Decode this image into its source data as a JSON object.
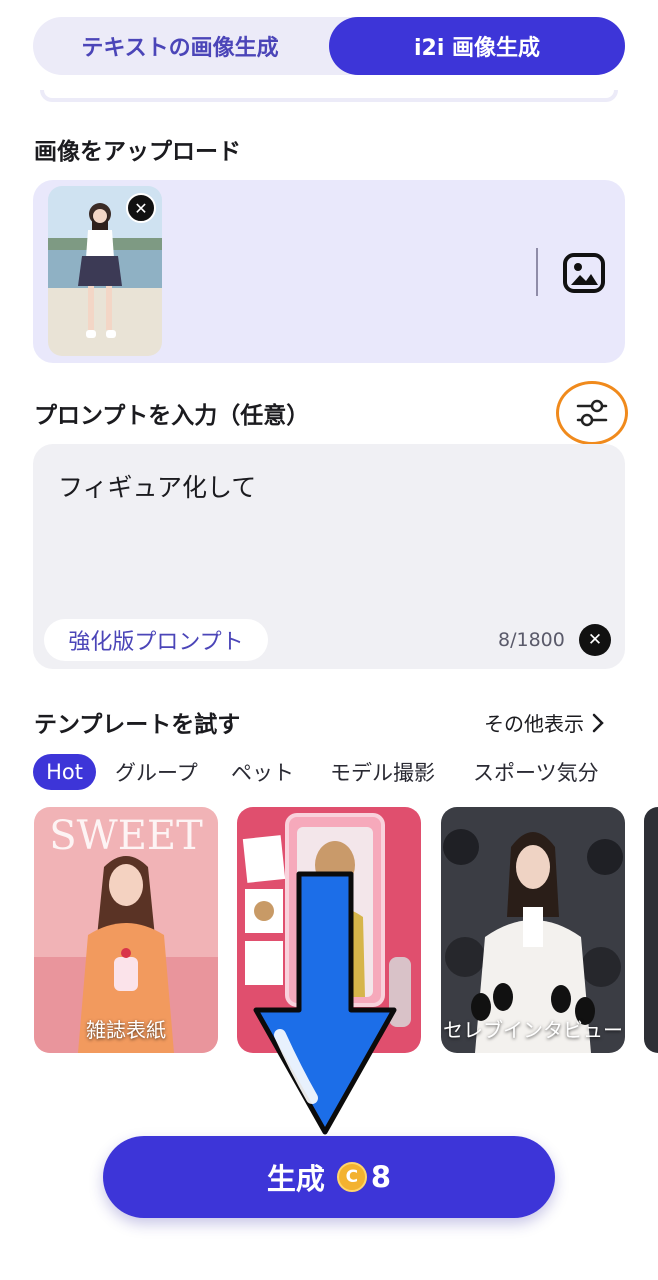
{
  "mode_tabs": {
    "text_to_image": "テキストの画像生成",
    "image_to_image": "i2i 画像生成",
    "active": "image_to_image"
  },
  "upload": {
    "label": "画像をアップロード"
  },
  "prompt": {
    "label": "プロンプトを入力（任意）",
    "value": "フィギュア化して",
    "enhance_label": "強化版プロンプト",
    "char_count": "8/1800"
  },
  "templates": {
    "label": "テンプレートを試す",
    "more_label": "その他表示",
    "categories": [
      "Hot",
      "グループ",
      "ペット",
      "モデル撮影",
      "スポーツ気分"
    ],
    "active_category": "Hot",
    "cards": [
      {
        "title": "雑誌表紙",
        "poster_text": "SWEET"
      },
      {
        "title": ""
      },
      {
        "title": "セレブインタビュー"
      }
    ]
  },
  "generate": {
    "label": "生成",
    "cost": "8",
    "coin_symbol": "C"
  },
  "colors": {
    "accent": "#3d35d8",
    "accent_soft": "#e9e8fb",
    "highlight_ring": "#f08a1c",
    "arrow": "#1c6ee8"
  }
}
